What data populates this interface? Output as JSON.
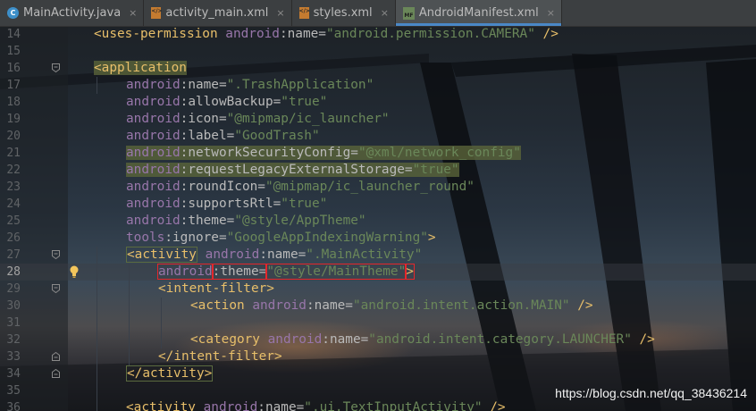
{
  "tabs": [
    {
      "label": "MainActivity.java",
      "icon": "java-class-icon"
    },
    {
      "label": "activity_main.xml",
      "icon": "xml-file-icon"
    },
    {
      "label": "styles.xml",
      "icon": "xml-file-icon"
    },
    {
      "label": "AndroidManifest.xml",
      "icon": "manifest-file-icon",
      "active": true
    }
  ],
  "tab_close_glyph": "×",
  "colors": {
    "tag": "#e8bf6a",
    "namespace": "#9876aa",
    "attribute": "#bababa",
    "value": "#6a8759",
    "line_number": "#606366",
    "error_box": "#e5262b",
    "active_tab_underline": "#4a88c7"
  },
  "lines": [
    {
      "n": "14",
      "tokens": [
        [
          "t",
          "<uses-permission "
        ],
        [
          "ns",
          "android"
        ],
        [
          "an",
          ":name="
        ],
        [
          "v",
          "\"android.permission.CAMERA\""
        ],
        [
          "t",
          " />"
        ]
      ]
    },
    {
      "n": "15",
      "tokens": []
    },
    {
      "n": "16",
      "fold": "open",
      "tokens": [
        [
          "t hl",
          "<application"
        ]
      ]
    },
    {
      "n": "17",
      "tokens": [
        [
          "ns",
          "android"
        ],
        [
          "an",
          ":name="
        ],
        [
          "v",
          "\".TrashApplication\""
        ]
      ]
    },
    {
      "n": "18",
      "tokens": [
        [
          "ns",
          "android"
        ],
        [
          "an",
          ":allowBackup="
        ],
        [
          "v",
          "\"true\""
        ]
      ]
    },
    {
      "n": "19",
      "tokens": [
        [
          "ns",
          "android"
        ],
        [
          "an",
          ":icon="
        ],
        [
          "v",
          "\"@mipmap/ic_launcher\""
        ]
      ]
    },
    {
      "n": "20",
      "tokens": [
        [
          "ns",
          "android"
        ],
        [
          "an",
          ":label="
        ],
        [
          "v",
          "\"GoodTrash\""
        ]
      ]
    },
    {
      "n": "21",
      "tokens": [
        [
          "ns hl",
          "android"
        ],
        [
          "an hl",
          ":networkSecurityConfig="
        ],
        [
          "v hl",
          "\"@xml/network_config\""
        ]
      ]
    },
    {
      "n": "22",
      "tokens": [
        [
          "ns hl",
          "android"
        ],
        [
          "an hl",
          ":requestLegacyExternalStorage="
        ],
        [
          "v hl",
          "\"true\""
        ]
      ]
    },
    {
      "n": "23",
      "tokens": [
        [
          "ns",
          "android"
        ],
        [
          "an",
          ":roundIcon="
        ],
        [
          "v",
          "\"@mipmap/ic_launcher_round\""
        ]
      ]
    },
    {
      "n": "24",
      "tokens": [
        [
          "ns",
          "android"
        ],
        [
          "an",
          ":supportsRtl="
        ],
        [
          "v",
          "\"true\""
        ]
      ]
    },
    {
      "n": "25",
      "tokens": [
        [
          "ns",
          "android"
        ],
        [
          "an",
          ":theme="
        ],
        [
          "v",
          "\"@style/AppTheme\""
        ]
      ]
    },
    {
      "n": "26",
      "tokens": [
        [
          "ns",
          "tools"
        ],
        [
          "an",
          ":ignore="
        ],
        [
          "v",
          "\"GoogleAppIndexingWarning\""
        ],
        [
          "t",
          ">"
        ]
      ]
    },
    {
      "n": "27",
      "fold": "open",
      "tokens": [
        [
          "t tagbox",
          "<activity"
        ],
        [
          "t",
          " "
        ],
        [
          "ns",
          "android"
        ],
        [
          "an",
          ":name="
        ],
        [
          "v",
          "\".MainActivity\""
        ]
      ]
    },
    {
      "n": "28",
      "current": true,
      "bulb": "intention-bulb-icon",
      "tokens": [
        [
          "ns errbox",
          "android"
        ],
        [
          "an errbox",
          ":theme="
        ],
        [
          "v errbox",
          "\"@style/MainTheme\""
        ],
        [
          "t errbox",
          ">"
        ]
      ]
    },
    {
      "n": "29",
      "fold": "open",
      "tokens": [
        [
          "t",
          "<intent-filter>"
        ]
      ]
    },
    {
      "n": "30",
      "tokens": [
        [
          "t",
          "<action "
        ],
        [
          "ns",
          "android"
        ],
        [
          "an",
          ":name="
        ],
        [
          "v",
          "\"android.intent.action.MAIN\""
        ],
        [
          "t",
          " />"
        ]
      ]
    },
    {
      "n": "31",
      "tokens": []
    },
    {
      "n": "32",
      "tokens": [
        [
          "t",
          "<category "
        ],
        [
          "ns",
          "android"
        ],
        [
          "an",
          ":name="
        ],
        [
          "v",
          "\"android.intent.category.LAUNCHER\""
        ],
        [
          "t",
          " />"
        ]
      ]
    },
    {
      "n": "33",
      "fold": "close",
      "tokens": [
        [
          "t",
          "</intent-filter>"
        ]
      ]
    },
    {
      "n": "34",
      "fold": "close",
      "tokens": [
        [
          "t tagbox",
          "</activity>"
        ]
      ]
    },
    {
      "n": "35",
      "tokens": []
    },
    {
      "n": "36",
      "tokens": [
        [
          "t",
          "<activity "
        ],
        [
          "ns",
          "android"
        ],
        [
          "an",
          ":name="
        ],
        [
          "v",
          "\".ui.TextInputActivity\""
        ],
        [
          "t",
          " />"
        ]
      ]
    }
  ],
  "watermark": "https://blog.csdn.net/qq_38436214"
}
